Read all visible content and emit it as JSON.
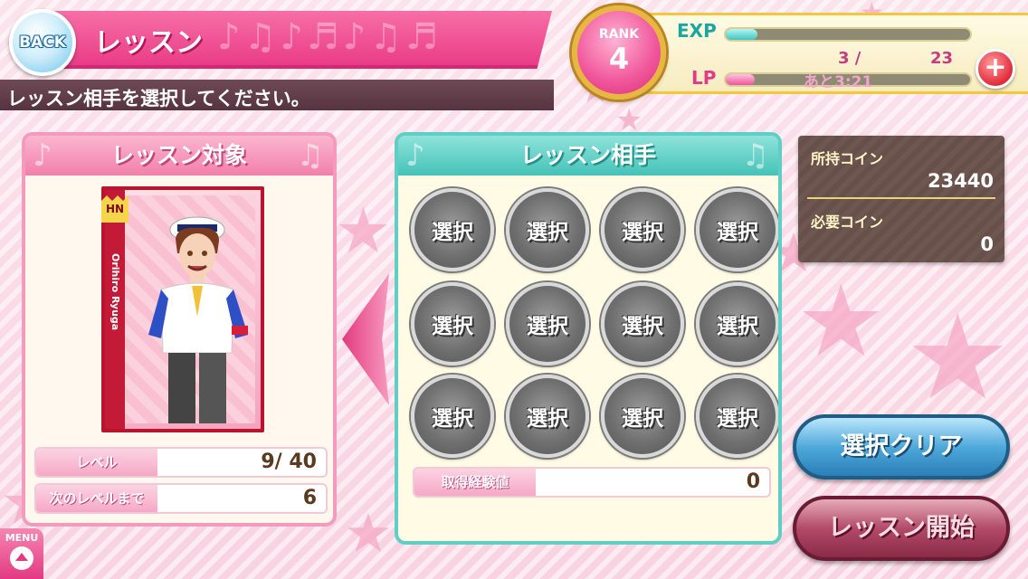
{
  "header": {
    "back_label": "BACK",
    "title": "レッスン",
    "instruction": "レッスン相手を選択してください。"
  },
  "status": {
    "rank_label": "RANK",
    "rank_value": "4",
    "exp_label": "EXP",
    "exp_current": "3 /",
    "exp_max": "23",
    "exp_fill_fraction": 0.13,
    "lp_label": "LP",
    "lp_fill_fraction": 0.12,
    "lp_timer": "あと3:21",
    "plus_label": "+"
  },
  "target_panel": {
    "title": "レッスン対象",
    "card": {
      "rarity": "HN",
      "name": "Orihiro Ryuga"
    },
    "level_label": "レベル",
    "level_value": "9/  40",
    "next_label": "次のレベルまで",
    "next_value": "6"
  },
  "partner_panel": {
    "title": "レッスン相手",
    "slots": [
      "選択",
      "選択",
      "選択",
      "選択",
      "選択",
      "選択",
      "選択",
      "選択",
      "選択",
      "選択",
      "選択",
      "選択"
    ],
    "exp_gain_label": "取得経験値",
    "exp_gain_value": "0"
  },
  "coins": {
    "owned_label": "所持コイン",
    "owned_value": "23440",
    "required_label": "必要コイン",
    "required_value": "0"
  },
  "actions": {
    "clear_label": "選択クリア",
    "start_label": "レッスン開始"
  },
  "menu": {
    "label": "MENU"
  },
  "colors": {
    "accent_pink": "#ea3c86",
    "accent_teal": "#45c2b8",
    "gold": "#e7b742"
  }
}
